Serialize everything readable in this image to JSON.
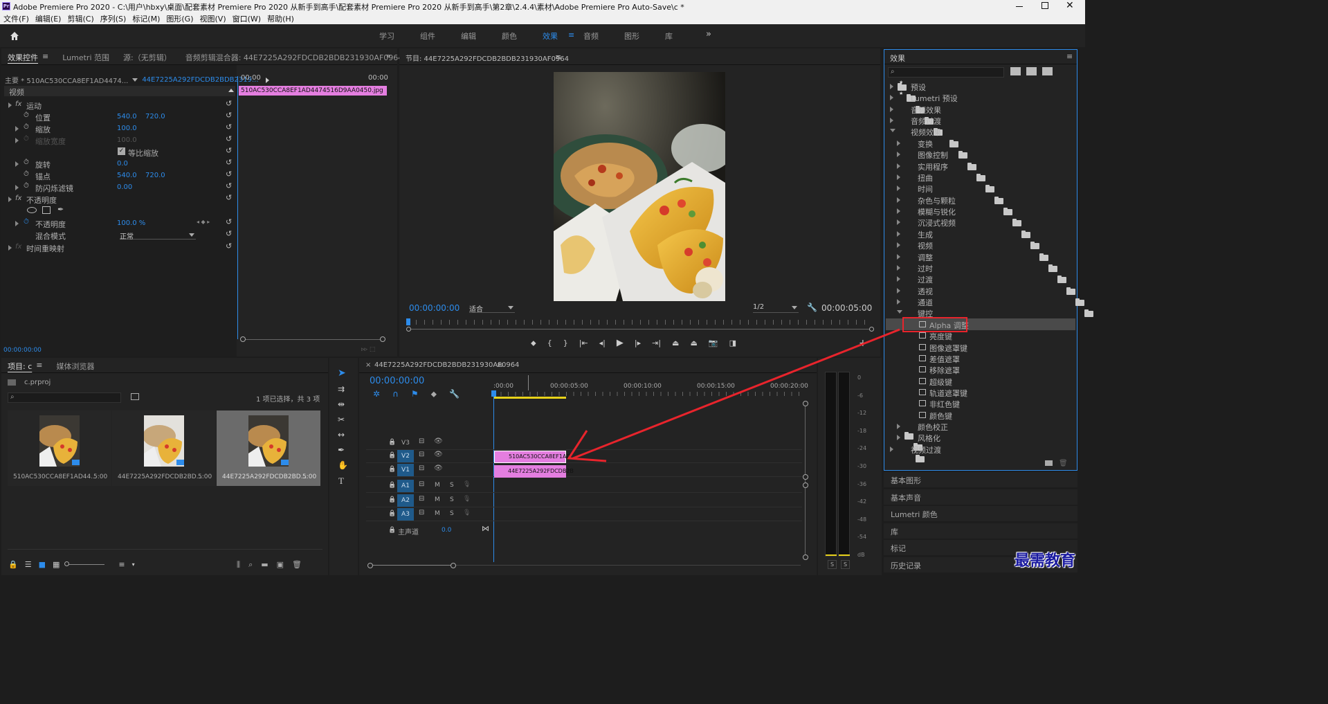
{
  "window": {
    "title": "Adobe Premiere Pro 2020 - C:\\用户\\hbxy\\桌面\\配套素材 Premiere Pro 2020 从新手到高手\\配套素材 Premiere Pro 2020 从新手到高手\\第2章\\2.4.4\\素材\\Adobe Premiere Pro Auto-Save\\c *",
    "app_badge": "Pr"
  },
  "menu": [
    "文件(F)",
    "编辑(E)",
    "剪辑(C)",
    "序列(S)",
    "标记(M)",
    "图形(G)",
    "视图(V)",
    "窗口(W)",
    "帮助(H)"
  ],
  "workspaces": [
    "学习",
    "组件",
    "编辑",
    "颜色",
    "效果",
    "音频",
    "图形",
    "库"
  ],
  "active_workspace_index": 4,
  "effect_controls": {
    "tabs": [
      "效果控件",
      "Lumetri 范围",
      "源:（无剪辑）",
      "音频剪辑混合器: 44E7225A292FDCDB2BDB231930AF0964"
    ],
    "master": "主要 * 510AC530CCA8EF1AD4474...",
    "sequence": "44E7225A292FDCDB2BDB2319...",
    "ruler_start": "00:00",
    "ruler_end": "00:00",
    "clip": "510AC530CCA8EF1AD4474516D9AA0450.jpg",
    "section_video": "视频",
    "motion": "运动",
    "position": "位置",
    "pos_x": "540.0",
    "pos_y": "720.0",
    "scale": "缩放",
    "scale_val": "100.0",
    "scale_width": "缩放宽度",
    "scale_width_val": "100.0",
    "uniform": "等比缩放",
    "rotation": "旋转",
    "rotation_val": "0.0",
    "anchor": "锚点",
    "anchor_x": "540.0",
    "anchor_y": "720.0",
    "flicker": "防闪烁滤镜",
    "flicker_val": "0.00",
    "opacity_group": "不透明度",
    "opacity": "不透明度",
    "opacity_val": "100.0 %",
    "blend": "混合模式",
    "blend_val": "正常",
    "time_remap": "时间重映射",
    "timecode": "00:00:00:00"
  },
  "program": {
    "title": "节目: 44E7225A292FDCDB2BDB231930AF0964",
    "tc_left": "00:00:00:00",
    "fit": "适合",
    "resolution": "1/2",
    "tc_right": "00:00:05:00"
  },
  "project": {
    "tabs": [
      "项目: c",
      "媒体浏览器"
    ],
    "file": "c.prproj",
    "status": "1 项已选择，共 3 项",
    "items": [
      {
        "name": "510AC530CCA8EF1AD44...",
        "dur": "5:00"
      },
      {
        "name": "44E7225A292FDCDB2BD...",
        "dur": "5:00"
      },
      {
        "name": "44E7225A292FDCDB2BD...",
        "dur": "5:00"
      }
    ]
  },
  "timeline": {
    "title": "44E7225A292FDCDB2BDB231930AF0964",
    "timecode": "00:00:00:00",
    "ruler": [
      ":00:00",
      "00:00:05:00",
      "00:00:10:00",
      "00:00:15:00",
      "00:00:20:00"
    ],
    "tracks": [
      "V3",
      "V2",
      "V1",
      "A1",
      "A2",
      "A3"
    ],
    "master": "主声道",
    "master_val": "0.0",
    "clip_v2": "510AC530CCA8EF1AD",
    "clip_v1": "44E7225A292FDCDB2B"
  },
  "meter": {
    "scale": [
      "0",
      "-6",
      "-12",
      "-18",
      "-24",
      "-30",
      "-36",
      "-42",
      "-48",
      "-54",
      "dB"
    ],
    "solo": [
      "S",
      "S"
    ]
  },
  "effects": {
    "title": "效果",
    "tree": [
      {
        "label": "预设",
        "depth": 0,
        "kind": "folder",
        "open": false,
        "badge": true
      },
      {
        "label": "Lumetri 预设",
        "depth": 0,
        "kind": "folder",
        "open": false,
        "badge": true
      },
      {
        "label": "音频效果",
        "depth": 0,
        "kind": "folder",
        "open": false
      },
      {
        "label": "音频过渡",
        "depth": 0,
        "kind": "folder",
        "open": false
      },
      {
        "label": "视频效果",
        "depth": 0,
        "kind": "folder",
        "open": true
      },
      {
        "label": "变换",
        "depth": 1,
        "kind": "folder",
        "open": false
      },
      {
        "label": "图像控制",
        "depth": 1,
        "kind": "folder",
        "open": false
      },
      {
        "label": "实用程序",
        "depth": 1,
        "kind": "folder",
        "open": false
      },
      {
        "label": "扭曲",
        "depth": 1,
        "kind": "folder",
        "open": false
      },
      {
        "label": "时间",
        "depth": 1,
        "kind": "folder",
        "open": false
      },
      {
        "label": "杂色与颗粒",
        "depth": 1,
        "kind": "folder",
        "open": false
      },
      {
        "label": "模糊与锐化",
        "depth": 1,
        "kind": "folder",
        "open": false
      },
      {
        "label": "沉浸式视频",
        "depth": 1,
        "kind": "folder",
        "open": false
      },
      {
        "label": "生成",
        "depth": 1,
        "kind": "folder",
        "open": false
      },
      {
        "label": "视频",
        "depth": 1,
        "kind": "folder",
        "open": false
      },
      {
        "label": "调整",
        "depth": 1,
        "kind": "folder",
        "open": false
      },
      {
        "label": "过时",
        "depth": 1,
        "kind": "folder",
        "open": false
      },
      {
        "label": "过渡",
        "depth": 1,
        "kind": "folder",
        "open": false
      },
      {
        "label": "透视",
        "depth": 1,
        "kind": "folder",
        "open": false
      },
      {
        "label": "通道",
        "depth": 1,
        "kind": "folder",
        "open": false
      },
      {
        "label": "键控",
        "depth": 1,
        "kind": "folder",
        "open": true
      },
      {
        "label": "Alpha 调整",
        "depth": 2,
        "kind": "effect",
        "selected": true
      },
      {
        "label": "亮度键",
        "depth": 2,
        "kind": "effect"
      },
      {
        "label": "图像遮罩键",
        "depth": 2,
        "kind": "effect"
      },
      {
        "label": "差值遮罩",
        "depth": 2,
        "kind": "effect"
      },
      {
        "label": "移除遮罩",
        "depth": 2,
        "kind": "effect"
      },
      {
        "label": "超级键",
        "depth": 2,
        "kind": "effect"
      },
      {
        "label": "轨道遮罩键",
        "depth": 2,
        "kind": "effect"
      },
      {
        "label": "非红色键",
        "depth": 2,
        "kind": "effect"
      },
      {
        "label": "颜色键",
        "depth": 2,
        "kind": "effect"
      },
      {
        "label": "颜色校正",
        "depth": 1,
        "kind": "folder",
        "open": false
      },
      {
        "label": "风格化",
        "depth": 1,
        "kind": "folder",
        "open": false
      },
      {
        "label": "视频过渡",
        "depth": 0,
        "kind": "folder",
        "open": false
      }
    ]
  },
  "side_panels": [
    "基本图形",
    "基本声音",
    "Lumetri 颜色",
    "库",
    "标记",
    "历史记录"
  ],
  "watermark": "最需教育",
  "colors": {
    "accent": "#2d8ceb",
    "clip": "#e47ee0",
    "highlight": "#e8242c"
  }
}
